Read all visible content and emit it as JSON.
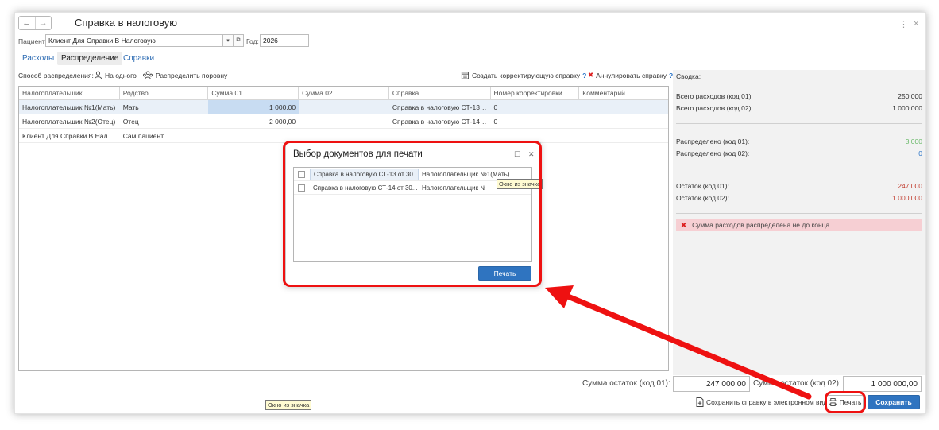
{
  "window": {
    "title": "Справка в налоговую",
    "back_icon": "arrow-left",
    "forward_icon": "arrow-right",
    "more_icon": "⋮",
    "close_icon": "×"
  },
  "header": {
    "patient_label": "Пациент:",
    "patient_value": "Клиент Для Справки В Налоговую",
    "year_label": "Год:",
    "year_value": "2026"
  },
  "tabs": [
    {
      "label": "Расходы",
      "active": false
    },
    {
      "label": "Распределение",
      "active": true
    },
    {
      "label": "Справки",
      "active": false
    }
  ],
  "toolbar": {
    "method_label": "Способ распределения:",
    "to_one": "На одного",
    "equally": "Распределить поровну",
    "create_corr": "Создать корректирующую справку",
    "annul": "Аннулировать справку",
    "help": "?"
  },
  "table": {
    "columns": [
      "Налогоплательщик",
      "Родство",
      "Сумма 01",
      "Сумма 02",
      "Справка",
      "Номер корректировки",
      "Комментарий"
    ],
    "rows": [
      {
        "payer": "Налогоплательщик №1(Мать)",
        "relation": "Мать",
        "sum01": "1 000,00",
        "sum02": "",
        "ref": "Справка в налоговую СТ-13 о...",
        "corr": "0",
        "comment": ""
      },
      {
        "payer": "Налогоплательщик №2(Отец)",
        "relation": "Отец",
        "sum01": "2 000,00",
        "sum02": "",
        "ref": "Справка в налоговую СТ-14 о...",
        "corr": "0",
        "comment": ""
      },
      {
        "payer": "Клиент Для Справки В Налого...",
        "relation": "Сам пациент",
        "sum01": "",
        "sum02": "",
        "ref": "",
        "corr": "",
        "comment": ""
      }
    ]
  },
  "summary": {
    "title": "Сводка:",
    "total01_label": "Всего расходов (код 01):",
    "total01_value": "250 000",
    "total02_label": "Всего расходов (код 02):",
    "total02_value": "1 000 000",
    "dist01_label": "Распределено (код 01):",
    "dist01_value": "3 000",
    "dist02_label": "Распределено (код 02):",
    "dist02_value": "0",
    "rem01_label": "Остаток (код 01):",
    "rem01_value": "247 000",
    "rem02_label": "Остаток (код 02):",
    "rem02_value": "1 000 000",
    "warning": "Сумма расходов распределена не до конца",
    "colors": {
      "green": "#6cba6c",
      "blue": "#2a74c7",
      "red": "#c0392b",
      "warn_bg": "#f6cfd3"
    }
  },
  "bottom": {
    "rem01_label": "Сумма остаток (код 01):",
    "rem01_value": "247 000,00",
    "rem02_label": "Сумма остаток (код 02):",
    "rem02_value": "1 000 000,00",
    "save_electronic": "Сохранить справку в электронном виде",
    "print": "Печать",
    "save": "Сохранить"
  },
  "dialog": {
    "title": "Выбор документов для печати",
    "rows": [
      {
        "doc": "Справка в налоговую СТ-13 от 30...",
        "payer": "Налогоплательщик №1(Мать)"
      },
      {
        "doc": "Справка в налоговую СТ-14 от 30...",
        "payer": "Налогоплательщик №"
      }
    ],
    "print_button": "Печать"
  },
  "tooltip": "Окно из значка",
  "annotation_color": "#ee1111"
}
